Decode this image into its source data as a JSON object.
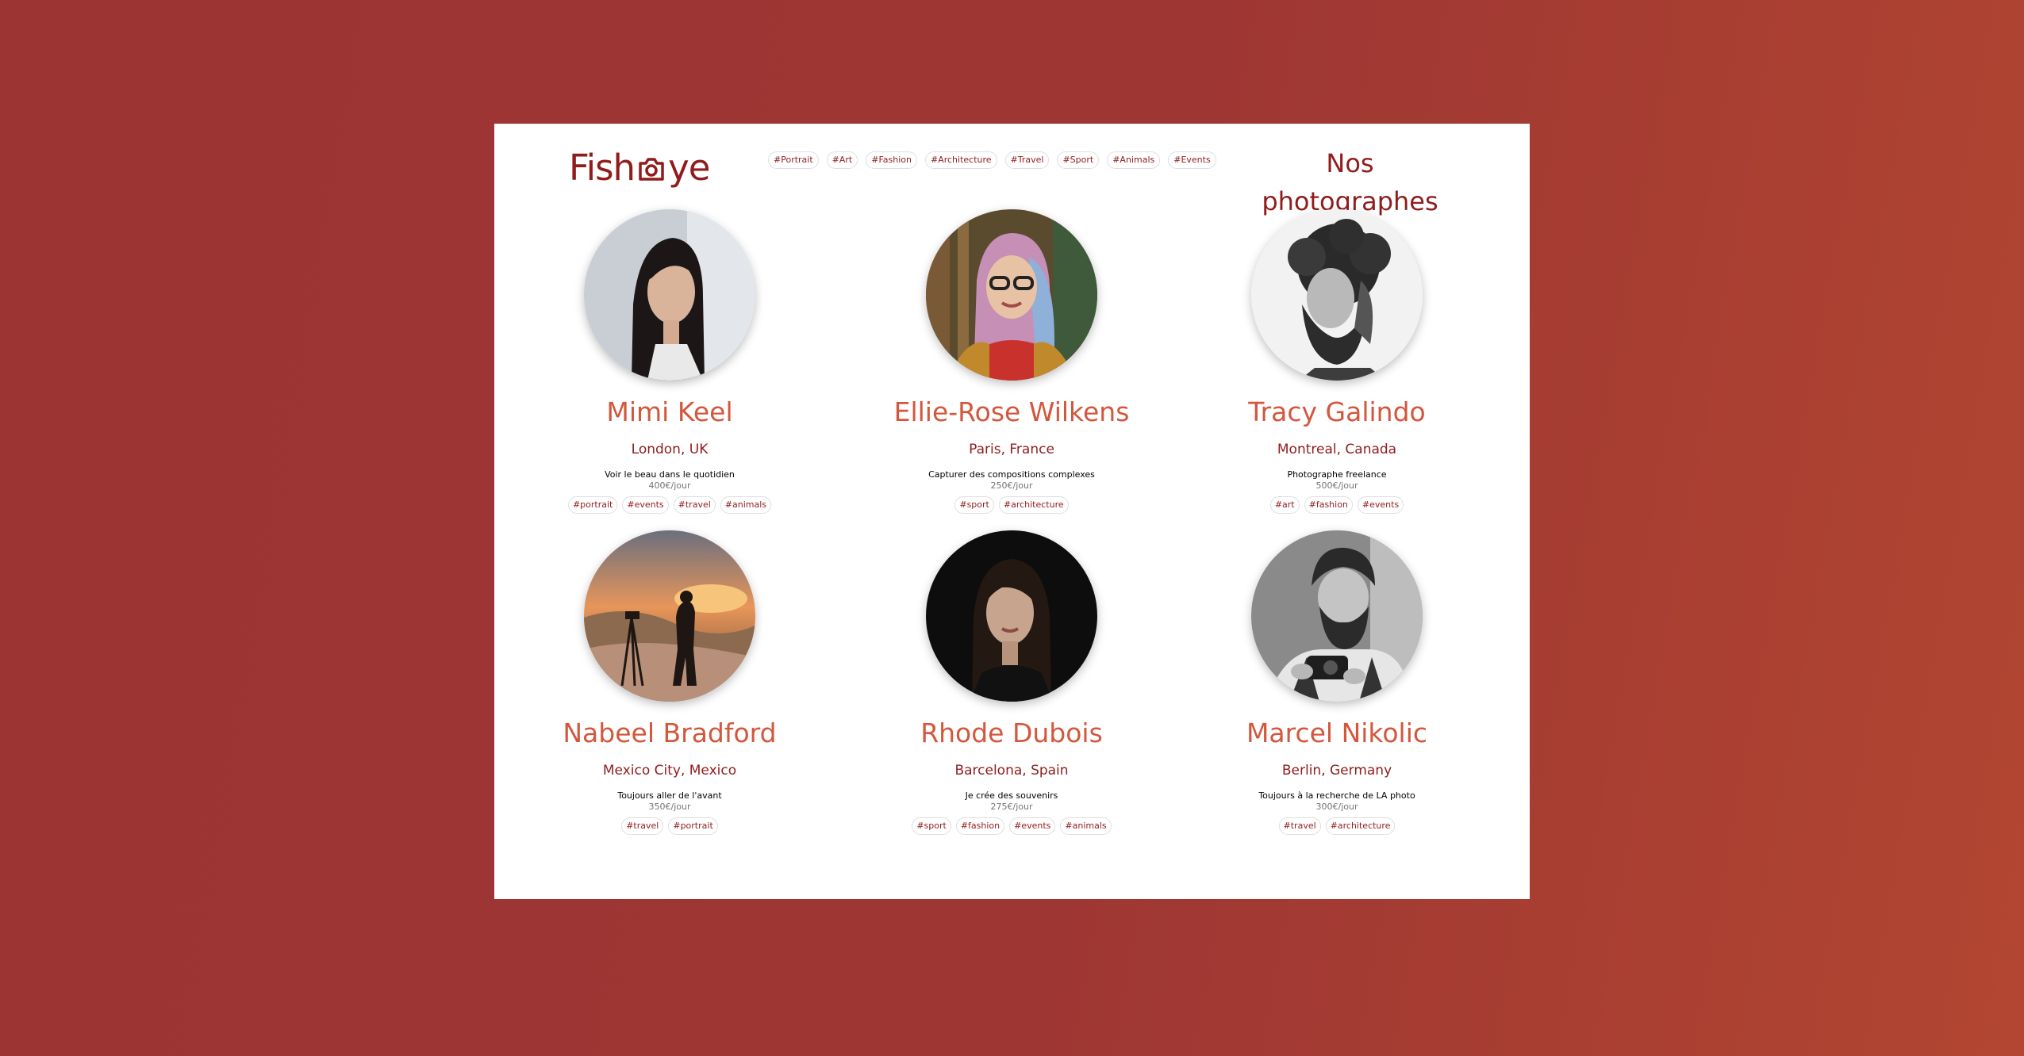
{
  "header": {
    "logo_text_before": "Fish",
    "logo_text_after": "ye",
    "logo_icon": "camera-icon",
    "nav_tags": [
      "#Portrait",
      "#Art",
      "#Fashion",
      "#Architecture",
      "#Travel",
      "#Sport",
      "#Animals",
      "#Events"
    ],
    "title": "Nos photographes"
  },
  "colors": {
    "brand": "#901c1c",
    "accent": "#d3573c",
    "background": "#9c3434"
  },
  "photographers": [
    {
      "name": "Mimi Keel",
      "location": "London, UK",
      "tagline": "Voir le beau dans le quotidien",
      "price": "400€/jour",
      "tags": [
        "#portrait",
        "#events",
        "#travel",
        "#animals"
      ],
      "photo": "portrait-photo"
    },
    {
      "name": "Ellie-Rose Wilkens",
      "location": "Paris, France",
      "tagline": "Capturer des compositions complexes",
      "price": "250€/jour",
      "tags": [
        "#sport",
        "#architecture"
      ],
      "photo": "portrait-photo"
    },
    {
      "name": "Tracy Galindo",
      "location": "Montreal, Canada",
      "tagline": "Photographe freelance",
      "price": "500€/jour",
      "tags": [
        "#art",
        "#fashion",
        "#events"
      ],
      "photo": "portrait-photo"
    },
    {
      "name": "Nabeel Bradford",
      "location": "Mexico City, Mexico",
      "tagline": "Toujours aller de l'avant",
      "price": "350€/jour",
      "tags": [
        "#travel",
        "#portrait"
      ],
      "photo": "landscape-photo"
    },
    {
      "name": "Rhode Dubois",
      "location": "Barcelona, Spain",
      "tagline": "Je crée des souvenirs",
      "price": "275€/jour",
      "tags": [
        "#sport",
        "#fashion",
        "#events",
        "#animals"
      ],
      "photo": "portrait-photo"
    },
    {
      "name": "Marcel Nikolic",
      "location": "Berlin, Germany",
      "tagline": "Toujours à la recherche de LA photo",
      "price": "300€/jour",
      "tags": [
        "#travel",
        "#architecture"
      ],
      "photo": "portrait-photo"
    }
  ]
}
